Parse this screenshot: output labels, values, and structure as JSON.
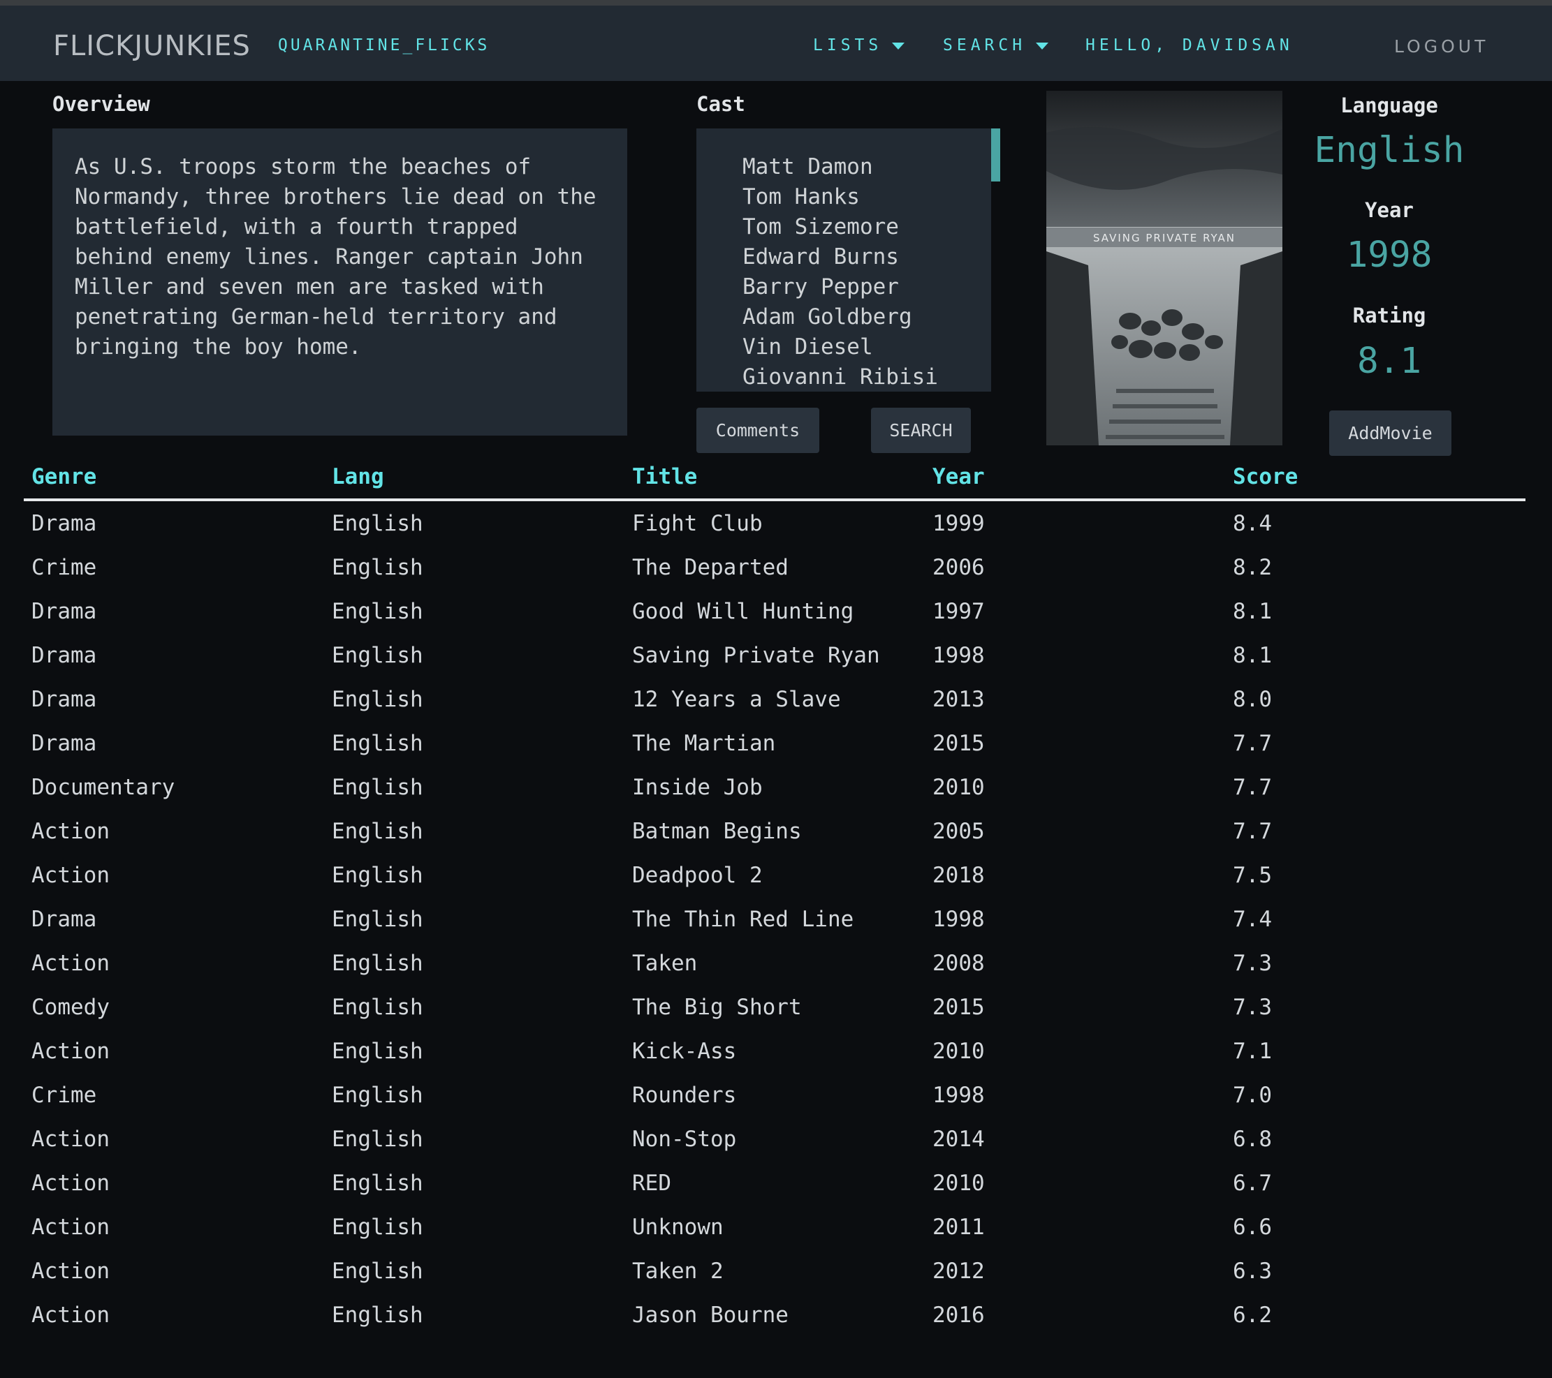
{
  "header": {
    "brand": "FLICKJUNKIES",
    "app_name": "QUARANTINE_FLICKS",
    "nav": {
      "lists": "LISTS",
      "search": "SEARCH",
      "hello": "HELLO, DAVIDSAN",
      "logout": "LOGOUT"
    }
  },
  "movie": {
    "overview_label": "Overview",
    "overview": "As U.S. troops storm the beaches of Normandy, three brothers lie dead on the battlefield, with a fourth trapped behind enemy lines. Ranger captain John Miller and seven men are tasked with penetrating German-held territory and bringing the boy home.",
    "cast_label": "Cast",
    "cast": [
      "Matt Damon",
      "Tom Hanks",
      "Tom Sizemore",
      "Edward Burns",
      "Barry Pepper",
      "Adam Goldberg",
      "Vin Diesel",
      "Giovanni Ribisi"
    ],
    "poster_title": "SAVING PRIVATE RYAN",
    "language_label": "Language",
    "language": "English",
    "year_label": "Year",
    "year": "1998",
    "rating_label": "Rating",
    "rating": "8.1",
    "buttons": {
      "comments": "Comments",
      "search": "SEARCH",
      "add": "AddMovie"
    }
  },
  "table": {
    "columns": [
      "Genre",
      "Lang",
      "Title",
      "Year",
      "Score"
    ],
    "rows": [
      [
        "Drama",
        "English",
        "Fight Club",
        "1999",
        "8.4"
      ],
      [
        "Crime",
        "English",
        "The Departed",
        "2006",
        "8.2"
      ],
      [
        "Drama",
        "English",
        "Good Will Hunting",
        "1997",
        "8.1"
      ],
      [
        "Drama",
        "English",
        "Saving Private Ryan",
        "1998",
        "8.1"
      ],
      [
        "Drama",
        "English",
        "12 Years a Slave",
        "2013",
        "8.0"
      ],
      [
        "Drama",
        "English",
        "The Martian",
        "2015",
        "7.7"
      ],
      [
        "Documentary",
        "English",
        "Inside Job",
        "2010",
        "7.7"
      ],
      [
        "Action",
        "English",
        "Batman Begins",
        "2005",
        "7.7"
      ],
      [
        "Action",
        "English",
        "Deadpool 2",
        "2018",
        "7.5"
      ],
      [
        "Drama",
        "English",
        "The Thin Red Line",
        "1998",
        "7.4"
      ],
      [
        "Action",
        "English",
        "Taken",
        "2008",
        "7.3"
      ],
      [
        "Comedy",
        "English",
        "The Big Short",
        "2015",
        "7.3"
      ],
      [
        "Action",
        "English",
        "Kick-Ass",
        "2010",
        "7.1"
      ],
      [
        "Crime",
        "English",
        "Rounders",
        "1998",
        "7.0"
      ],
      [
        "Action",
        "English",
        "Non-Stop",
        "2014",
        "6.8"
      ],
      [
        "Action",
        "English",
        "RED",
        "2010",
        "6.7"
      ],
      [
        "Action",
        "English",
        "Unknown",
        "2011",
        "6.6"
      ],
      [
        "Action",
        "English",
        "Taken 2",
        "2012",
        "6.3"
      ],
      [
        "Action",
        "English",
        "Jason Bourne",
        "2016",
        "6.2"
      ]
    ]
  },
  "colors": {
    "accent_cyan": "#62e3e6",
    "accent_teal": "#4aa5a3",
    "panel": "#222a33",
    "background": "#0b0d10"
  }
}
